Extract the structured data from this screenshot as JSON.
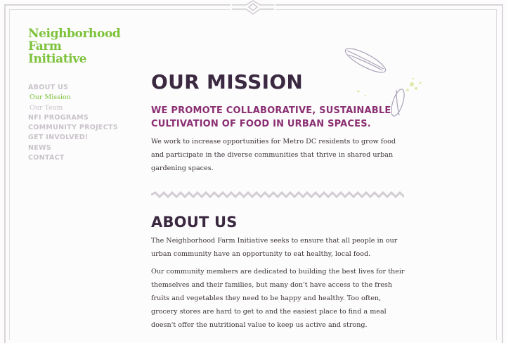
{
  "logo": {
    "line1": "Neighborhood",
    "line2": "Farm",
    "line3": "Initiative"
  },
  "nav": {
    "about": "ABOUT US",
    "our_mission": "Our Mission",
    "our_team": "Our Team",
    "programs": "NFI PROGRAMS",
    "community": "COMMUNITY PROJECTS",
    "get_involved": "GET INVOLVED!",
    "news": "NEWS",
    "contact": "CONTACT"
  },
  "mission": {
    "heading": "OUR MISSION",
    "tagline": "WE PROMOTE COLLABORATIVE, SUSTAINABLE CULTIVATION OF FOOD IN URBAN SPACES.",
    "body": "We work to increase opportunities for Metro DC residents to grow food and participate in the diverse communities that thrive in shared urban gardening spaces."
  },
  "about": {
    "heading": "ABOUT US",
    "para1": "The Neighborhood Farm Initiative seeks to ensure that all people in our urban community have an opportunity to eat healthy, local food.",
    "para2": "Our community members are dedicated to building the best lives for their themselves and their families, but many don't have access to the fresh fruits and vegetables they need to be happy and healthy. Too often, grocery stores are hard to get to and the easiest place to find a meal doesn't offer the nutritional value to keep us active and strong."
  },
  "colors": {
    "brand_green": "#7cc23a",
    "heading_purple": "#3a2940",
    "tagline_magenta": "#8a2f72",
    "nav_gray": "#c8c3c9"
  }
}
